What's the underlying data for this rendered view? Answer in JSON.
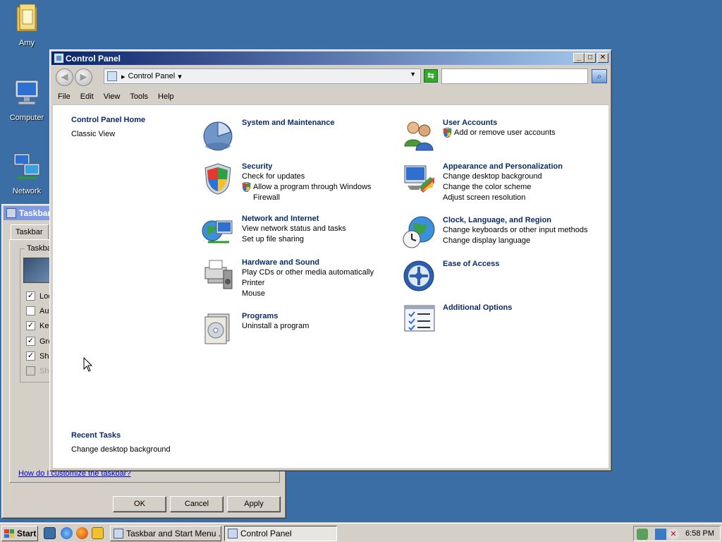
{
  "desktop": {
    "icons": [
      {
        "label": "Amy",
        "icon": "folder-user-icon"
      },
      {
        "label": "Computer",
        "icon": "computer-icon"
      },
      {
        "label": "Network",
        "icon": "network-icon"
      }
    ]
  },
  "background_dialog": {
    "title": "Taskbar",
    "tab": "Taskbar",
    "group_label": "Taskbar",
    "checkboxes": [
      {
        "label": "Loc",
        "checked": true,
        "enabled": true
      },
      {
        "label": "Aut",
        "checked": false,
        "enabled": true
      },
      {
        "label": "Kee",
        "checked": true,
        "enabled": true
      },
      {
        "label": "Gro",
        "checked": true,
        "enabled": true
      },
      {
        "label": "Sho",
        "checked": true,
        "enabled": true
      },
      {
        "label": "Sho",
        "checked": false,
        "enabled": false
      }
    ],
    "help_link": "How do I customize the taskbar?",
    "buttons": {
      "ok": "OK",
      "cancel": "Cancel",
      "apply": "Apply"
    }
  },
  "control_panel": {
    "title": "Control Panel",
    "caption": {
      "minimize": "_",
      "maximize": "□",
      "close": "✕"
    },
    "address": {
      "segment": "Control Panel"
    },
    "search": {
      "placeholder": ""
    },
    "menu": [
      "File",
      "Edit",
      "View",
      "Tools",
      "Help"
    ],
    "sidebar": {
      "home": "Control Panel Home",
      "classic_view": "Classic View",
      "recent_tasks_title": "Recent Tasks",
      "recent_tasks": [
        "Change desktop background"
      ]
    },
    "categories": [
      {
        "title": "System and Maintenance",
        "icon": "system-maintenance-icon",
        "links": []
      },
      {
        "title": "Security",
        "icon": "security-shield-icon",
        "links": [
          {
            "text": "Check for updates",
            "shield": false
          },
          {
            "text": "Allow a program through Windows Firewall",
            "shield": true
          }
        ]
      },
      {
        "title": "Network and Internet",
        "icon": "network-internet-icon",
        "links": [
          {
            "text": "View network status and tasks",
            "shield": false
          },
          {
            "text": "Set up file sharing",
            "shield": false
          }
        ]
      },
      {
        "title": "Hardware and Sound",
        "icon": "hardware-sound-icon",
        "links": [
          {
            "text": "Play CDs or other media automatically",
            "shield": false
          },
          {
            "text": "Printer",
            "shield": false
          },
          {
            "text": "Mouse",
            "shield": false
          }
        ]
      },
      {
        "title": "Programs",
        "icon": "programs-icon",
        "links": [
          {
            "text": "Uninstall a program",
            "shield": false
          }
        ]
      },
      {
        "title": "User Accounts",
        "icon": "user-accounts-icon",
        "links": [
          {
            "text": "Add or remove user accounts",
            "shield": true
          }
        ]
      },
      {
        "title": "Appearance and Personalization",
        "icon": "appearance-icon",
        "links": [
          {
            "text": "Change desktop background",
            "shield": false
          },
          {
            "text": "Change the color scheme",
            "shield": false
          },
          {
            "text": "Adjust screen resolution",
            "shield": false
          }
        ]
      },
      {
        "title": "Clock, Language, and Region",
        "icon": "clock-globe-icon",
        "links": [
          {
            "text": "Change keyboards or other input methods",
            "shield": false
          },
          {
            "text": "Change display language",
            "shield": false
          }
        ]
      },
      {
        "title": "Ease of Access",
        "icon": "ease-of-access-icon",
        "links": []
      },
      {
        "title": "Additional Options",
        "icon": "additional-options-icon",
        "links": []
      }
    ]
  },
  "taskbar": {
    "start_label": "Start",
    "tasks": [
      {
        "label": "Taskbar and Start Menu ...",
        "active": false
      },
      {
        "label": "Control Panel",
        "active": true
      }
    ],
    "clock": "6:58 PM"
  },
  "colors": {
    "desktop": "#3a6ea5",
    "link_title": "#0b2a6a",
    "title_active_start": "#0a246a",
    "title_active_end": "#a6caf0"
  }
}
